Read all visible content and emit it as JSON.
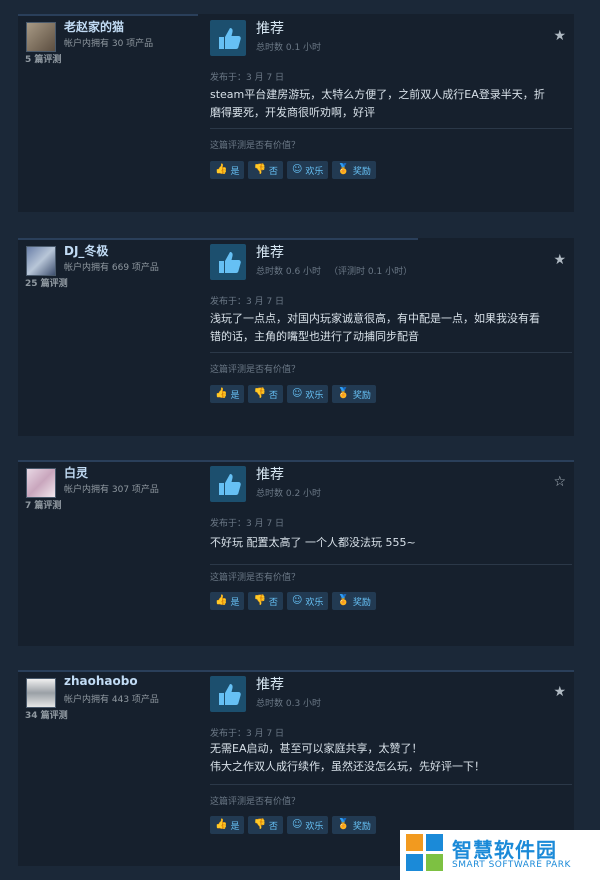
{
  "reviews": [
    {
      "username": "老赵家的猫",
      "owns": "帐户内拥有 30 项产品",
      "review_count": "5 篇评测",
      "recommendation": "推荐",
      "hours_total": "总时数 0.1 小时",
      "hours_at_review": "",
      "posted": "发布于：3 月 7 日",
      "lines": [
        "steam平台建房游玩，太特么方便了，之前双人成行EA登录半天，折",
        "磨得要死，开发商很听劝啊，好评"
      ],
      "star_filled": true
    },
    {
      "username": "DJ_冬极",
      "owns": "帐户内拥有 669 项产品",
      "review_count": "25 篇评测",
      "recommendation": "推荐",
      "hours_total": "总时数 0.6 小时",
      "hours_at_review": "（评测时 0.1 小时）",
      "posted": "发布于：3 月 7 日",
      "lines": [
        "浅玩了一点点，对国内玩家诚意很高，有中配是一点，如果我没有看",
        "错的话，主角的嘴型也进行了动捕同步配音"
      ],
      "star_filled": true
    },
    {
      "username": "白灵",
      "owns": "帐户内拥有 307 项产品",
      "review_count": "7 篇评测",
      "recommendation": "推荐",
      "hours_total": "总时数 0.2 小时",
      "hours_at_review": "",
      "posted": "发布于：3 月 7 日",
      "lines": [
        "不好玩 配置太高了 一个人都没法玩 555~"
      ],
      "star_filled": false
    },
    {
      "username": "zhaohaobo",
      "owns": "帐户内拥有 443 项产品",
      "review_count": "34 篇评测",
      "recommendation": "推荐",
      "hours_total": "总时数 0.3 小时",
      "hours_at_review": "",
      "posted": "发布于：3 月 7 日",
      "lines": [
        "无需EA启动，甚至可以家庭共享，太赞了！",
        "伟大之作双人成行续作，虽然还没怎么玩，先好评一下！"
      ],
      "star_filled": true
    }
  ],
  "helpful_question": "这篇评测是否有价值？",
  "buttons": {
    "yes": "是",
    "no": "否",
    "funny": "欢乐",
    "award": "奖励"
  },
  "watermark": {
    "name": "智慧软件园",
    "name_en": "SMART SOFTWARE PARK"
  },
  "colors": {
    "background": "#1b2838",
    "card": "#16202d",
    "link": "#67c1f5",
    "thumb": "#1c4f6e",
    "watermark_blue": "#1b8ad8"
  }
}
